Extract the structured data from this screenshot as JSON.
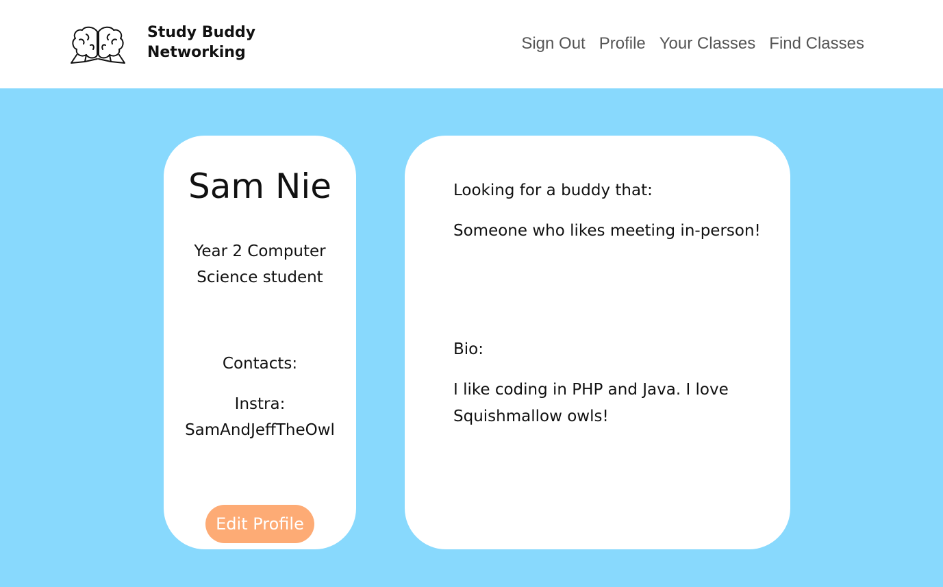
{
  "header": {
    "brand_line1": "Study Buddy",
    "brand_line2": "Networking",
    "logo_icon": "brain-pair-icon",
    "background": "#ffffff"
  },
  "nav": {
    "items": [
      {
        "label": "Sign Out"
      },
      {
        "label": "Profile"
      },
      {
        "label": "Your Classes"
      },
      {
        "label": "Find Classes"
      }
    ]
  },
  "profile": {
    "name": "Sam Nie",
    "subtitle": "Year 2 Computer Science student",
    "contacts_label": "Contacts:",
    "contact_value": "Instra: SamAndJeffTheOwl",
    "edit_button": "Edit Profile",
    "looking_label": "Looking for a buddy that:",
    "looking_value": "Someone who likes meeting in-person!",
    "bio_label": "Bio:",
    "bio_value": "I like coding in PHP and Java. I love Squishmallow owls!"
  },
  "colors": {
    "page_background": "#88d9fd",
    "card_background": "#ffffff",
    "button": "#fdab75",
    "nav_text": "#555555"
  }
}
